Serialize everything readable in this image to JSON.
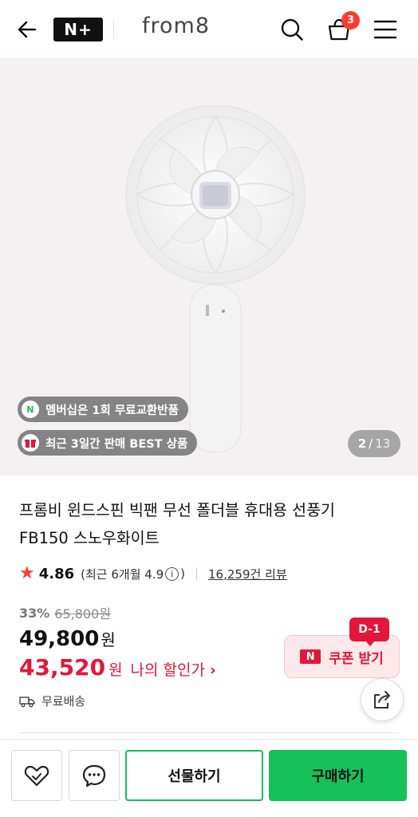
{
  "header": {
    "badge_text": "N+",
    "brand": "from8",
    "cart_count": "3"
  },
  "hero": {
    "pill_membership": "멤버십은 1회 무료교환반품",
    "pill_best": "최근 3일간 판매 BEST 상품",
    "image_index": "2",
    "image_sep": "/",
    "image_total": "13"
  },
  "product": {
    "title_line1": "프롬비 윈드스핀 빅팬 무선 폴더블 휴대용 선풍기",
    "title_line2": "FB150 스노우화이트",
    "rating": "4.86",
    "recent_rating_text": "(최근 6개월 4.9",
    "recent_rating_close": ")",
    "review_count": "16,259건 리뷰",
    "discount_pct": "33%",
    "original_price": "65,800원",
    "price": "49,800",
    "price_unit": "원",
    "my_price": "43,520",
    "my_price_unit": "원",
    "my_price_label": "나의 할인가",
    "shipping": "무료배송"
  },
  "coupon": {
    "d_tag": "D-1",
    "logo": "N",
    "label": "쿠폰 받기"
  },
  "actions": {
    "gift": "선물하기",
    "buy": "구매하기"
  },
  "colors": {
    "accent_green": "#16c05b",
    "accent_red": "#e2173a",
    "badge_red": "#ff3b30"
  }
}
